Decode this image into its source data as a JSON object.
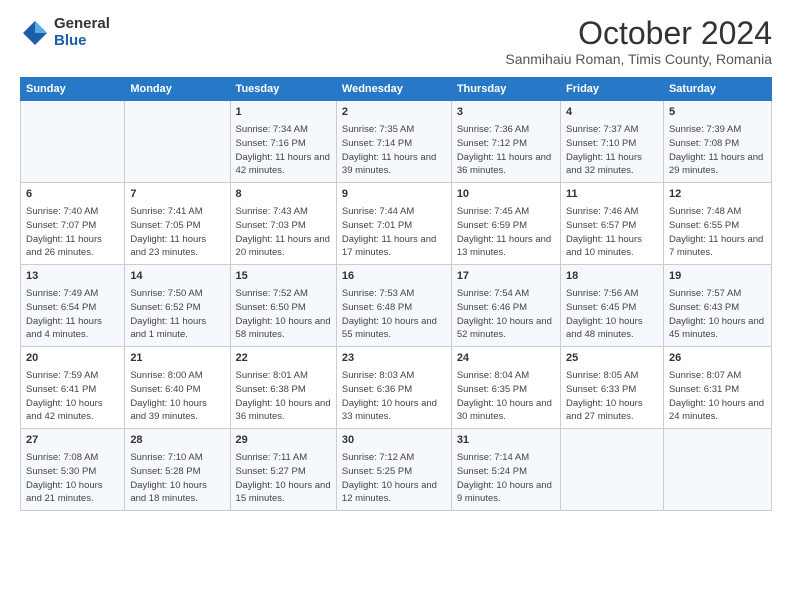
{
  "logo": {
    "general": "General",
    "blue": "Blue"
  },
  "header": {
    "month": "October 2024",
    "location": "Sanmihaiu Roman, Timis County, Romania"
  },
  "days_of_week": [
    "Sunday",
    "Monday",
    "Tuesday",
    "Wednesday",
    "Thursday",
    "Friday",
    "Saturday"
  ],
  "weeks": [
    [
      {
        "day": "",
        "info": ""
      },
      {
        "day": "",
        "info": ""
      },
      {
        "day": "1",
        "info": "Sunrise: 7:34 AM\nSunset: 7:16 PM\nDaylight: 11 hours and 42 minutes."
      },
      {
        "day": "2",
        "info": "Sunrise: 7:35 AM\nSunset: 7:14 PM\nDaylight: 11 hours and 39 minutes."
      },
      {
        "day": "3",
        "info": "Sunrise: 7:36 AM\nSunset: 7:12 PM\nDaylight: 11 hours and 36 minutes."
      },
      {
        "day": "4",
        "info": "Sunrise: 7:37 AM\nSunset: 7:10 PM\nDaylight: 11 hours and 32 minutes."
      },
      {
        "day": "5",
        "info": "Sunrise: 7:39 AM\nSunset: 7:08 PM\nDaylight: 11 hours and 29 minutes."
      }
    ],
    [
      {
        "day": "6",
        "info": "Sunrise: 7:40 AM\nSunset: 7:07 PM\nDaylight: 11 hours and 26 minutes."
      },
      {
        "day": "7",
        "info": "Sunrise: 7:41 AM\nSunset: 7:05 PM\nDaylight: 11 hours and 23 minutes."
      },
      {
        "day": "8",
        "info": "Sunrise: 7:43 AM\nSunset: 7:03 PM\nDaylight: 11 hours and 20 minutes."
      },
      {
        "day": "9",
        "info": "Sunrise: 7:44 AM\nSunset: 7:01 PM\nDaylight: 11 hours and 17 minutes."
      },
      {
        "day": "10",
        "info": "Sunrise: 7:45 AM\nSunset: 6:59 PM\nDaylight: 11 hours and 13 minutes."
      },
      {
        "day": "11",
        "info": "Sunrise: 7:46 AM\nSunset: 6:57 PM\nDaylight: 11 hours and 10 minutes."
      },
      {
        "day": "12",
        "info": "Sunrise: 7:48 AM\nSunset: 6:55 PM\nDaylight: 11 hours and 7 minutes."
      }
    ],
    [
      {
        "day": "13",
        "info": "Sunrise: 7:49 AM\nSunset: 6:54 PM\nDaylight: 11 hours and 4 minutes."
      },
      {
        "day": "14",
        "info": "Sunrise: 7:50 AM\nSunset: 6:52 PM\nDaylight: 11 hours and 1 minute."
      },
      {
        "day": "15",
        "info": "Sunrise: 7:52 AM\nSunset: 6:50 PM\nDaylight: 10 hours and 58 minutes."
      },
      {
        "day": "16",
        "info": "Sunrise: 7:53 AM\nSunset: 6:48 PM\nDaylight: 10 hours and 55 minutes."
      },
      {
        "day": "17",
        "info": "Sunrise: 7:54 AM\nSunset: 6:46 PM\nDaylight: 10 hours and 52 minutes."
      },
      {
        "day": "18",
        "info": "Sunrise: 7:56 AM\nSunset: 6:45 PM\nDaylight: 10 hours and 48 minutes."
      },
      {
        "day": "19",
        "info": "Sunrise: 7:57 AM\nSunset: 6:43 PM\nDaylight: 10 hours and 45 minutes."
      }
    ],
    [
      {
        "day": "20",
        "info": "Sunrise: 7:59 AM\nSunset: 6:41 PM\nDaylight: 10 hours and 42 minutes."
      },
      {
        "day": "21",
        "info": "Sunrise: 8:00 AM\nSunset: 6:40 PM\nDaylight: 10 hours and 39 minutes."
      },
      {
        "day": "22",
        "info": "Sunrise: 8:01 AM\nSunset: 6:38 PM\nDaylight: 10 hours and 36 minutes."
      },
      {
        "day": "23",
        "info": "Sunrise: 8:03 AM\nSunset: 6:36 PM\nDaylight: 10 hours and 33 minutes."
      },
      {
        "day": "24",
        "info": "Sunrise: 8:04 AM\nSunset: 6:35 PM\nDaylight: 10 hours and 30 minutes."
      },
      {
        "day": "25",
        "info": "Sunrise: 8:05 AM\nSunset: 6:33 PM\nDaylight: 10 hours and 27 minutes."
      },
      {
        "day": "26",
        "info": "Sunrise: 8:07 AM\nSunset: 6:31 PM\nDaylight: 10 hours and 24 minutes."
      }
    ],
    [
      {
        "day": "27",
        "info": "Sunrise: 7:08 AM\nSunset: 5:30 PM\nDaylight: 10 hours and 21 minutes."
      },
      {
        "day": "28",
        "info": "Sunrise: 7:10 AM\nSunset: 5:28 PM\nDaylight: 10 hours and 18 minutes."
      },
      {
        "day": "29",
        "info": "Sunrise: 7:11 AM\nSunset: 5:27 PM\nDaylight: 10 hours and 15 minutes."
      },
      {
        "day": "30",
        "info": "Sunrise: 7:12 AM\nSunset: 5:25 PM\nDaylight: 10 hours and 12 minutes."
      },
      {
        "day": "31",
        "info": "Sunrise: 7:14 AM\nSunset: 5:24 PM\nDaylight: 10 hours and 9 minutes."
      },
      {
        "day": "",
        "info": ""
      },
      {
        "day": "",
        "info": ""
      }
    ]
  ]
}
